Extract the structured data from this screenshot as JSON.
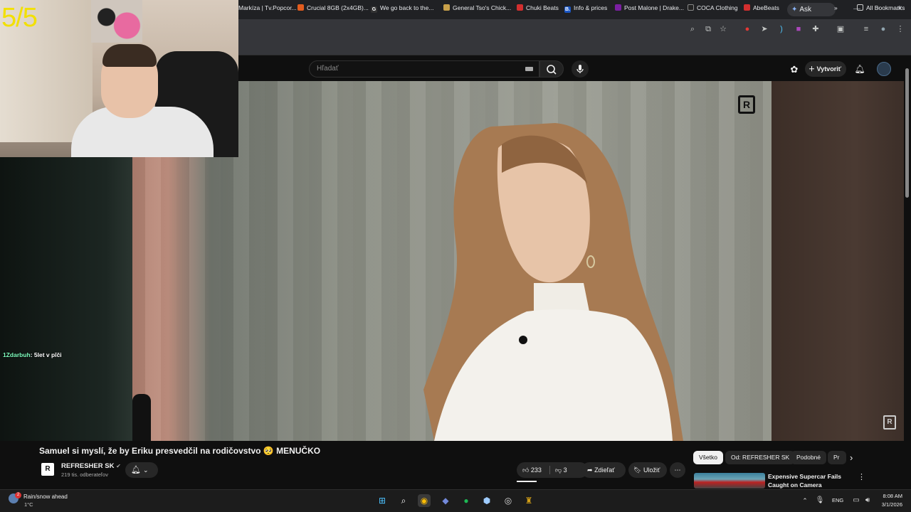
{
  "browser": {
    "ask_gemini": "Ask Gemini",
    "bookmarks": [
      {
        "label": "Markíza | Tv.Popcor...",
        "color": "#f0a020"
      },
      {
        "label": "Crucial 8GB (2x4GB)...",
        "color": "#e25c1e"
      },
      {
        "label": "We go back to the...",
        "color": "#333333",
        "glyph": "G"
      },
      {
        "label": "General Tso's Chick...",
        "color": "#c9a14a"
      },
      {
        "label": "Chuki Beats",
        "color": "#d32f2f"
      },
      {
        "label": "Info & prices",
        "color": "#1a56c4",
        "glyph": "B."
      },
      {
        "label": "Post Malone | Drake...",
        "color": "#7b1fa2"
      },
      {
        "label": "COCA Clothing",
        "color": "#222222"
      },
      {
        "label": "AbeBeats",
        "color": "#d32f2f"
      }
    ],
    "all_bookmarks": "All Bookmarks"
  },
  "youtube": {
    "search_placeholder": "Hľadať",
    "create_label": "Vytvoriť",
    "video_title": "Samuel si myslí, že by Eriku presvedčil na rodičovstvo 🥺 MENUČKO",
    "channel": {
      "name": "REFRESHER SK",
      "subscribers": "219 tis. odberateľov",
      "avatar_text": "R"
    },
    "likes": "233",
    "dislikes": "3",
    "share_label": "Zdieľať",
    "save_label": "Uložiť",
    "chips": [
      "Všetko",
      "Od: REFRESHER SK",
      "Podobné",
      "Pr"
    ],
    "recommended": {
      "title": "Expensive Supercar Fails Caught on Camera"
    },
    "logo_text": "R"
  },
  "stream_overlay": {
    "counter": "5/5",
    "chat": {
      "user": "1Zdarbuh",
      "message": ": 5let v pīči"
    }
  },
  "taskbar": {
    "weather_text": "Rain/snow ahead",
    "weather_temp": "1°C",
    "weather_badge": "2",
    "language": "ENG",
    "time": "8:08 AM",
    "date": "3/1/2026"
  }
}
